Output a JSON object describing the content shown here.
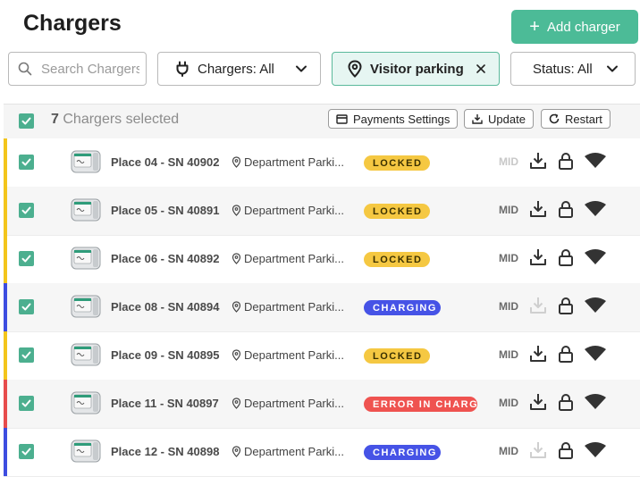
{
  "page": {
    "title": "Chargers"
  },
  "actions": {
    "add_label": "Add charger"
  },
  "filters": {
    "search_placeholder": "Search Chargers",
    "chargers": "Chargers: All",
    "location": "Visitor parking",
    "status": "Status: All"
  },
  "selection": {
    "count": "7",
    "label": "Chargers selected",
    "payments_label": "Payments Settings",
    "update_label": "Update",
    "restart_label": "Restart"
  },
  "colors": {
    "accent": "#4cbb97",
    "locked_bar": "#f3c51b",
    "charging_bar": "#3d4de0",
    "error_bar": "#e74c4c",
    "locked_badge": "#f5c842",
    "charging_badge": "#4653e6",
    "error_badge": "#ef5350"
  },
  "rows": [
    {
      "place": "Place 04 - SN 40902",
      "location": "Department Parki...",
      "status": "LOCKED",
      "kind": "locked",
      "mid": "MID",
      "mid_dim": true,
      "download_dim": false,
      "alt": false
    },
    {
      "place": "Place 05 - SN 40891",
      "location": "Department Parki...",
      "status": "LOCKED",
      "kind": "locked",
      "mid": "MID",
      "mid_dim": false,
      "download_dim": false,
      "alt": true
    },
    {
      "place": "Place 06 - SN 40892",
      "location": "Department Parki...",
      "status": "LOCKED",
      "kind": "locked",
      "mid": "MID",
      "mid_dim": false,
      "download_dim": false,
      "alt": false
    },
    {
      "place": "Place 08 - SN 40894",
      "location": "Department Parki...",
      "status": "CHARGING",
      "kind": "charging",
      "mid": "MID",
      "mid_dim": false,
      "download_dim": true,
      "alt": true
    },
    {
      "place": "Place 09 - SN 40895",
      "location": "Department Parki...",
      "status": "LOCKED",
      "kind": "locked",
      "mid": "MID",
      "mid_dim": false,
      "download_dim": false,
      "alt": false
    },
    {
      "place": "Place 11 - SN 40897",
      "location": "Department Parki...",
      "status": "ERROR IN CHARGER",
      "kind": "error",
      "mid": "MID",
      "mid_dim": false,
      "download_dim": false,
      "alt": true
    },
    {
      "place": "Place 12 - SN 40898",
      "location": "Department Parki...",
      "status": "CHARGING",
      "kind": "charging",
      "mid": "MID",
      "mid_dim": false,
      "download_dim": true,
      "alt": false
    }
  ]
}
